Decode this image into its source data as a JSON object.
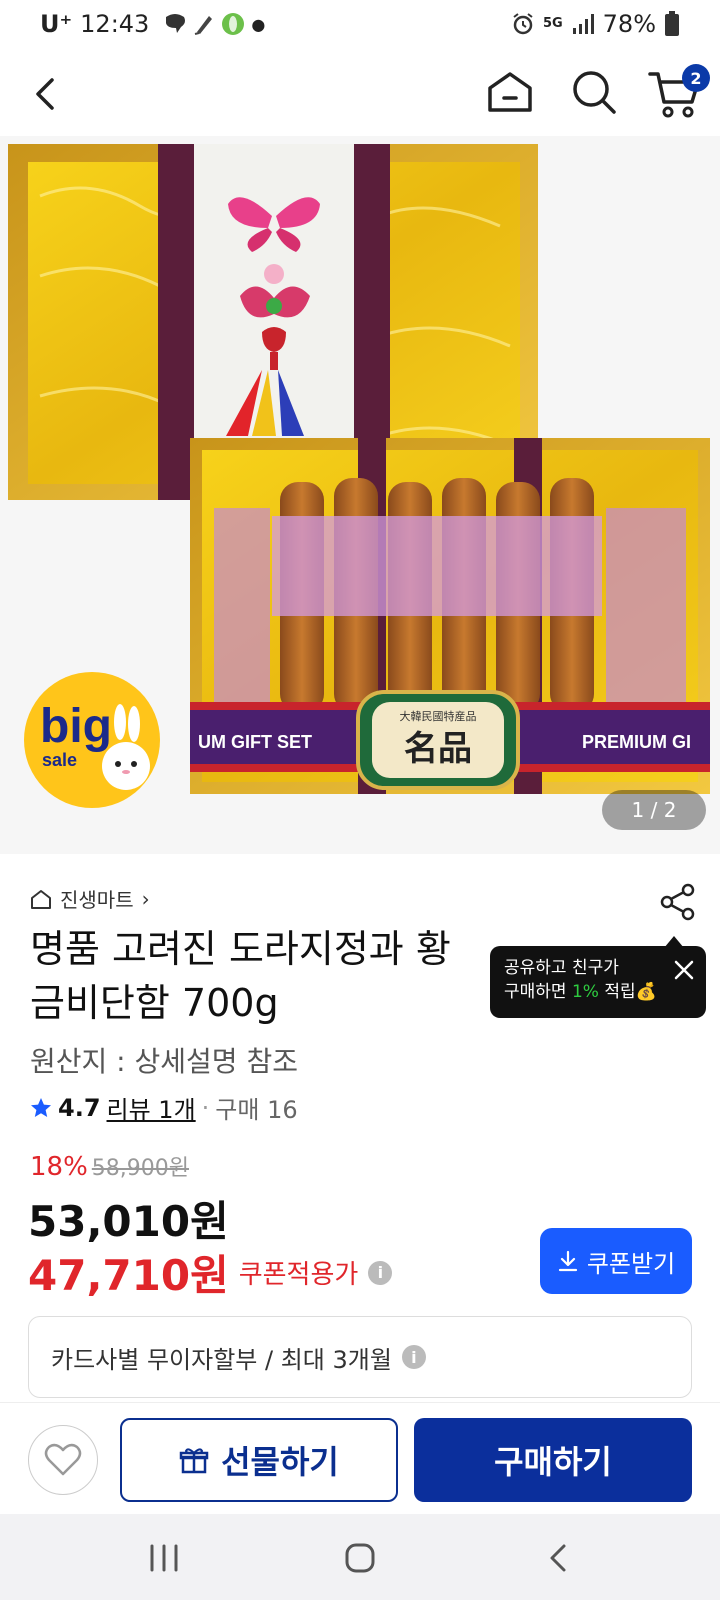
{
  "status_bar": {
    "carrier": "U⁺",
    "time": "12:43",
    "network": "5G",
    "battery": "78%"
  },
  "header": {
    "cart_count": "2"
  },
  "gallery": {
    "page_indicator": "1 / 2",
    "big_sale_word": "big",
    "big_sale_sub": "sale",
    "banner_left": "UM GIFT SET",
    "banner_right": "PREMIUM GI",
    "plaque_top": "大韓民國特産品",
    "plaque_main": "名品"
  },
  "product": {
    "store_name": "진생마트",
    "store_chevron": "›",
    "title": "명품 고려진 도라지정과 황금비단함 700g",
    "origin": "원산지 : 상세설명 참조",
    "rating": "4.7",
    "review_link": "리뷰 1개",
    "separator": "·",
    "purchase_count": "구매 16",
    "discount_rate": "18%",
    "original_price": "58,900원",
    "sale_price": "53,010원",
    "coupon_price": "47,710원",
    "coupon_label": "쿠폰적용가",
    "coupon_button": "쿠폰받기",
    "installment": "카드사별 무이자할부 / 최대 3개월"
  },
  "tooltip": {
    "line1": "공유하고 친구가",
    "line2_prefix": "구매하면 ",
    "line2_highlight": "1%",
    "line2_suffix": " 적립💰"
  },
  "actions": {
    "gift_label": "선물하기",
    "buy_label": "구매하기"
  },
  "colors": {
    "accent_blue": "#1a5cff",
    "buy_navy": "#0b2f9c",
    "discount_red": "#e0262b"
  }
}
